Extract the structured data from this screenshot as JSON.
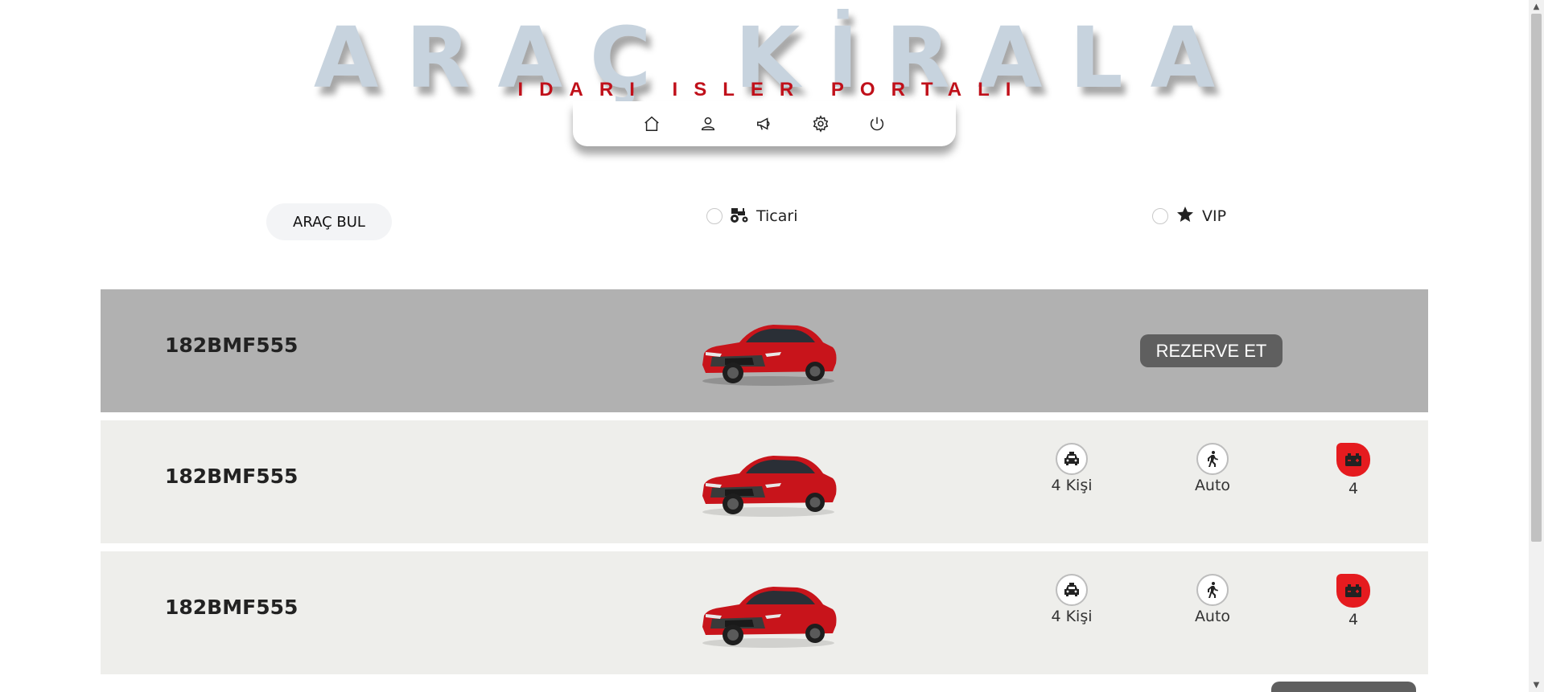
{
  "header": {
    "title": "ARAÇ KİRALA",
    "subtitle": "IDARI ISLER PORTALI",
    "nav": [
      {
        "icon": "home-icon"
      },
      {
        "icon": "user-icon"
      },
      {
        "icon": "megaphone-icon"
      },
      {
        "icon": "gear-icon"
      },
      {
        "icon": "power-icon"
      }
    ]
  },
  "filters": {
    "find_label": "ARAÇ BUL",
    "options": [
      {
        "label": "Ticari",
        "icon": "tractor-icon"
      },
      {
        "label": "VIP",
        "icon": "star-icon"
      }
    ]
  },
  "vehicles": [
    {
      "plate": "182BMF555",
      "reserve_label": "REZERVE ET"
    },
    {
      "plate": "182BMF555",
      "capacity": "4 Kişi",
      "transmission": "Auto",
      "fuel": "4"
    },
    {
      "plate": "182BMF555",
      "capacity": "4 Kişi",
      "transmission": "Auto",
      "fuel": "4"
    }
  ],
  "colors": {
    "title": "#c7d3de",
    "subtitle": "#c0101a",
    "active_row": "#b1b1b1",
    "row": "#eeeeeb",
    "reserve_button": "#5f5f5f",
    "fuel_badge": "#e51b1f"
  }
}
